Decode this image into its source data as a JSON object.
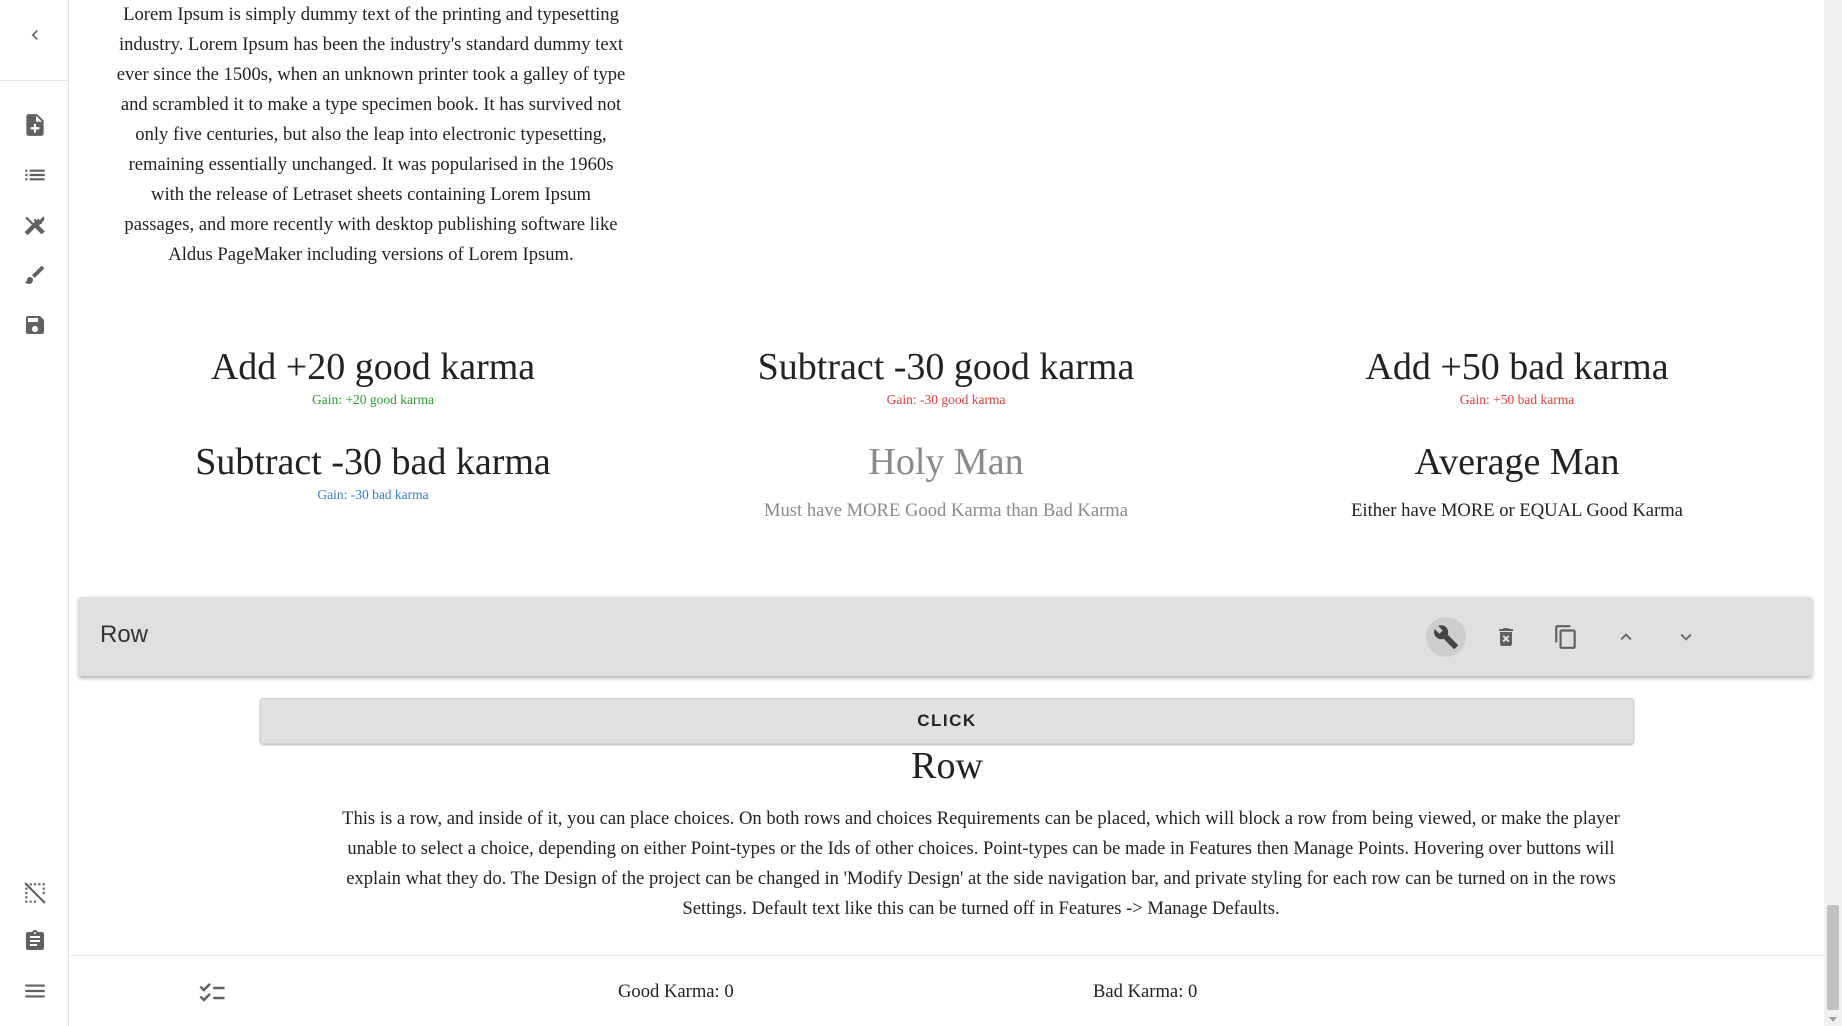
{
  "intro_text": "Lorem Ipsum is simply dummy text of the printing and typesetting industry. Lorem Ipsum has been the industry's standard dummy text ever since the 1500s, when an unknown printer took a galley of type and scrambled it to make a type specimen book. It has survived not only five centuries, but also the leap into electronic typesetting, remaining essentially unchanged. It was popularised in the 1960s with the release of Letraset sheets containing Lorem Ipsum passages, and more recently with desktop publishing software like Aldus PageMaker including versions of Lorem Ipsum.",
  "choices": [
    {
      "title": "Add +20 good karma",
      "gain": "Gain: +20  good karma",
      "gain_color": "#2e9e2e"
    },
    {
      "title": "Subtract -30 good karma",
      "gain": "Gain: -30  good karma",
      "gain_color": "#e03b3b"
    },
    {
      "title": "Add +50 bad karma",
      "gain": "Gain: +50 bad karma",
      "gain_color": "#e03b3b"
    },
    {
      "title": "Subtract -30 bad karma",
      "gain": "Gain: -30 bad karma",
      "gain_color": "#2e7fd1"
    },
    {
      "title": "Holy Man",
      "requirement": "Must have MORE Good Karma than Bad Karma",
      "disabled": true
    },
    {
      "title": "Average Man",
      "requirement": "Either have MORE or EQUAL Good Karma"
    }
  ],
  "row_toolbar": {
    "label": "Row",
    "actions": [
      "wrench-icon",
      "delete-icon",
      "copy-icon",
      "chevron-up-icon",
      "chevron-down-icon"
    ]
  },
  "click_button": "CLICK",
  "row": {
    "title": "Row",
    "text": "This is a row, and inside of it, you can place choices. On both rows and choices Requirements can be placed, which will block a row from being viewed, or make the player unable to select a choice, depending on either Point-types or the Ids of other choices. Point-types can be made in Features then Manage Points. Hovering over buttons will explain what they do. The Design of the project can be changed in 'Modify Design' at the side navigation bar, and private styling for each row can be turned on in the rows Settings. Default text like this can be turned off in Features -> Manage Defaults."
  },
  "points": {
    "good": "Good Karma: 0",
    "bad": "Bad Karma: 0"
  },
  "sidebar_icons": [
    "back-icon",
    "new-file-icon",
    "list-icon",
    "tools-icon",
    "brush-icon",
    "save-icon",
    "grid-off-icon",
    "clipboard-icon",
    "menu-icon"
  ]
}
